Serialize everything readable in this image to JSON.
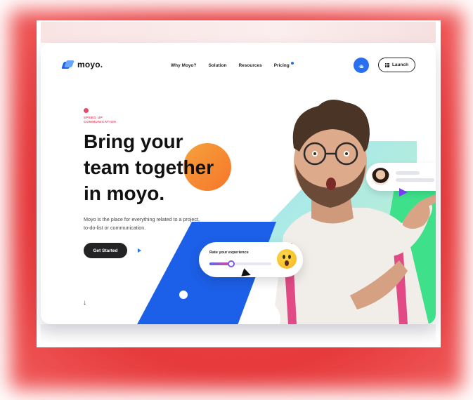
{
  "brand": {
    "name": "moyo."
  },
  "nav": {
    "items": [
      "Why Moyo?",
      "Solution",
      "Resources",
      "Pricing"
    ],
    "launch_label": "Launch"
  },
  "hero": {
    "eyebrow": "SPEED UP COMMUNICATION",
    "headline_lines": [
      "Bring your",
      "team together",
      "in moyo."
    ],
    "description": "Moyo is the place for everything related to a project, to-do-list or communication.",
    "cta_label": "Get Started"
  },
  "rating_card": {
    "title": "Rate your experience",
    "level_percent": 35
  },
  "icons": {
    "logo": "moyo-logo-icon",
    "user": "user-avatar-icon",
    "grid": "grid-icon",
    "play": "play-icon",
    "down": "arrow-down-icon",
    "emoji": "surprised-emoji-icon",
    "cursor": "cursor-pointer-icon"
  },
  "colors": {
    "frame": "#e8373a",
    "brand_blue": "#1c5fe8",
    "accent_orange": "#f5762a",
    "accent_pink": "#e84a6a",
    "accent_green": "#3ee08a",
    "dark": "#232326"
  }
}
